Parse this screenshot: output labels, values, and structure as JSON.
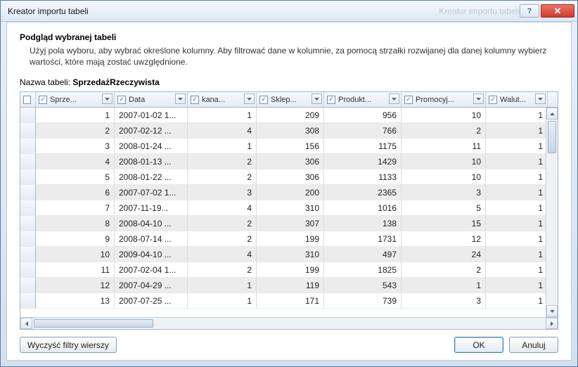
{
  "window": {
    "title": "Kreator importu tabeli",
    "ghost_title": "Kreator importu tabeli"
  },
  "header": {
    "title": "Podgląd wybranej tabeli",
    "description": "Użyj pola wyboru, aby wybrać określone kolumny. Aby filtrować dane w kolumnie, za pomocą strzałki rozwijanej dla danej kolumny wybierz wartości, które mają zostać uwzględnione."
  },
  "table_name_label": "Nazwa tabeli:",
  "table_name_value": "SprzedażRzeczywista",
  "columns": [
    "Sprze...",
    "Data",
    "kana...",
    "Sklep...",
    "Produkt...",
    "Promocyj...",
    "Walut..."
  ],
  "columns_checked": [
    true,
    true,
    true,
    true,
    true,
    true,
    true
  ],
  "rows": [
    {
      "n": 1,
      "d": "2007-01-02 1...",
      "c2": 1,
      "c3": 209,
      "c4": 956,
      "c5": 10,
      "c6": 1
    },
    {
      "n": 2,
      "d": "2007-02-12 ...",
      "c2": 4,
      "c3": 308,
      "c4": 766,
      "c5": 2,
      "c6": 1
    },
    {
      "n": 3,
      "d": "2008-01-24 ...",
      "c2": 1,
      "c3": 156,
      "c4": 1175,
      "c5": 11,
      "c6": 1
    },
    {
      "n": 4,
      "d": "2008-01-13 ...",
      "c2": 2,
      "c3": 306,
      "c4": 1429,
      "c5": 10,
      "c6": 1
    },
    {
      "n": 5,
      "d": "2008-01-22 ...",
      "c2": 2,
      "c3": 306,
      "c4": 1133,
      "c5": 10,
      "c6": 1
    },
    {
      "n": 6,
      "d": "2007-07-02 1...",
      "c2": 3,
      "c3": 200,
      "c4": 2365,
      "c5": 3,
      "c6": 1
    },
    {
      "n": 7,
      "d": "2007-11-19...",
      "c2": 4,
      "c3": 310,
      "c4": 1016,
      "c5": 5,
      "c6": 1
    },
    {
      "n": 8,
      "d": "2008-04-10 ...",
      "c2": 2,
      "c3": 307,
      "c4": 138,
      "c5": 15,
      "c6": 1
    },
    {
      "n": 9,
      "d": "2008-07-14 ...",
      "c2": 2,
      "c3": 199,
      "c4": 1731,
      "c5": 12,
      "c6": 1
    },
    {
      "n": 10,
      "d": "2009-04-10 ...",
      "c2": 4,
      "c3": 310,
      "c4": 497,
      "c5": 24,
      "c6": 1
    },
    {
      "n": 11,
      "d": "2007-02-04 1...",
      "c2": 2,
      "c3": 199,
      "c4": 1825,
      "c5": 2,
      "c6": 1
    },
    {
      "n": 12,
      "d": "2007-04-29 ...",
      "c2": 1,
      "c3": 119,
      "c4": 543,
      "c5": 1,
      "c6": 1
    },
    {
      "n": 13,
      "d": "2007-07-25 ...",
      "c2": 1,
      "c3": 171,
      "c4": 739,
      "c5": 3,
      "c6": 1
    }
  ],
  "buttons": {
    "clear_filters": "Wyczyść filtry wierszy",
    "ok": "OK",
    "cancel": "Anuluj"
  }
}
